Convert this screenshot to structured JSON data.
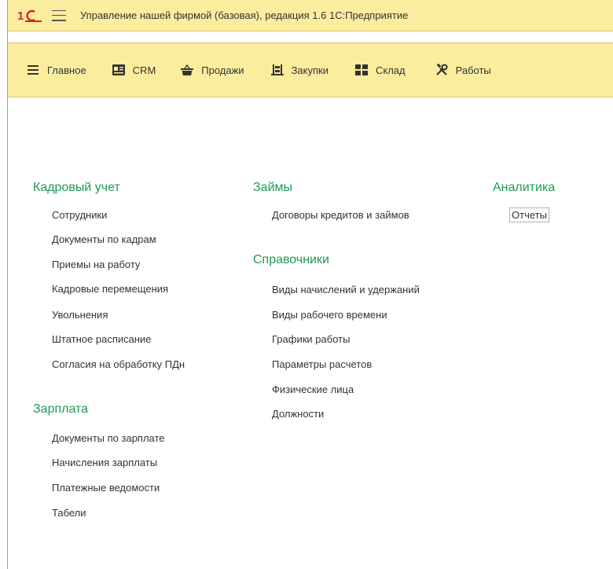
{
  "window": {
    "title": "Управление нашей фирмой (базовая), редакция 1.6 1С:Предприятие"
  },
  "colors": {
    "panel": "#fbed9e",
    "group_title": "#1e9b55",
    "logo_red": "#d8232a"
  },
  "sections": [
    {
      "icon": "menu-lines-icon",
      "label": "Главное"
    },
    {
      "icon": "crm-card-icon",
      "label": "CRM"
    },
    {
      "icon": "basket-icon",
      "label": "Продажи"
    },
    {
      "icon": "purchases-icon",
      "label": "Закупки"
    },
    {
      "icon": "warehouse-icon",
      "label": "Склад"
    },
    {
      "icon": "tools-icon",
      "label": "Работы"
    }
  ],
  "groups": {
    "hr": {
      "title": "Кадровый учет",
      "items": [
        "Сотрудники",
        "Документы по кадрам",
        "Приемы на работу",
        "Кадровые перемещения",
        "Увольнения",
        "Штатное расписание",
        "Согласия на обработку ПДн"
      ]
    },
    "salary": {
      "title": "Зарплата",
      "items": [
        "Документы по зарплате",
        "Начисления зарплаты",
        "Платежные ведомости",
        "Табели"
      ]
    },
    "loans": {
      "title": "Займы",
      "items": [
        "Договоры кредитов и займов"
      ]
    },
    "references": {
      "title": "Справочники",
      "items": [
        "Виды начислений и удержаний",
        "Виды рабочего времени",
        "Графики работы",
        "Параметры расчетов",
        "Физические лица",
        "Должности"
      ]
    },
    "analytics": {
      "title": "Аналитика",
      "items": [
        "Отчеты"
      ]
    }
  }
}
